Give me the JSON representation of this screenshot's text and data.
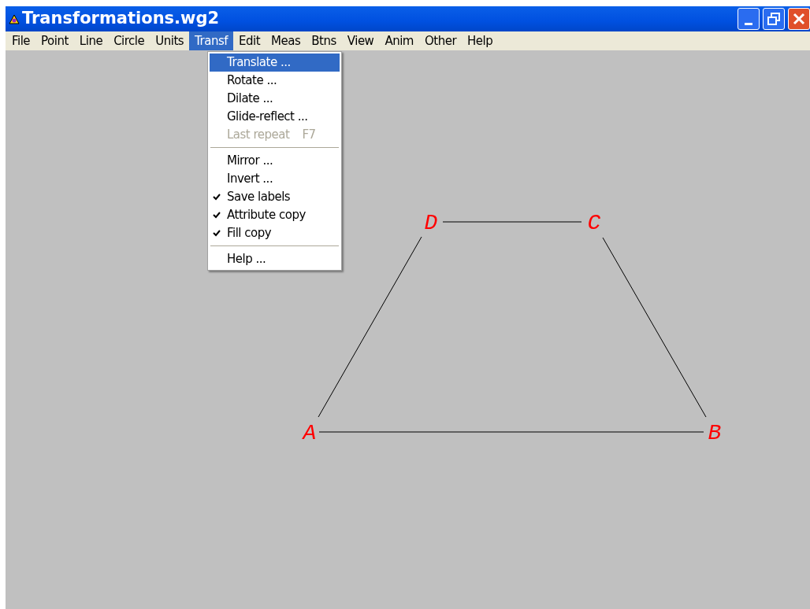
{
  "window": {
    "title": "Transformations.wg2"
  },
  "menu_bar": [
    {
      "label": "File",
      "selected": false
    },
    {
      "label": "Point",
      "selected": false
    },
    {
      "label": "Line",
      "selected": false
    },
    {
      "label": "Circle",
      "selected": false
    },
    {
      "label": "Units",
      "selected": false
    },
    {
      "label": "Transf",
      "selected": true
    },
    {
      "label": "Edit",
      "selected": false
    },
    {
      "label": "Meas",
      "selected": false
    },
    {
      "label": "Btns",
      "selected": false
    },
    {
      "label": "View",
      "selected": false
    },
    {
      "label": "Anim",
      "selected": false
    },
    {
      "label": "Other",
      "selected": false
    },
    {
      "label": "Help",
      "selected": false
    }
  ],
  "dropdown": [
    {
      "kind": "item",
      "label": "Translate ...",
      "selected": true,
      "disabled": false,
      "checked": false
    },
    {
      "kind": "item",
      "label": "Rotate ...",
      "selected": false,
      "disabled": false,
      "checked": false
    },
    {
      "kind": "item",
      "label": "Dilate ...",
      "selected": false,
      "disabled": false,
      "checked": false
    },
    {
      "kind": "item",
      "label": "Glide-reflect ...",
      "selected": false,
      "disabled": false,
      "checked": false
    },
    {
      "kind": "item",
      "label": "Last repeat",
      "shortcut": "F7",
      "selected": false,
      "disabled": true,
      "checked": false
    },
    {
      "kind": "separator"
    },
    {
      "kind": "item",
      "label": "Mirror ...",
      "selected": false,
      "disabled": false,
      "checked": false
    },
    {
      "kind": "item",
      "label": "Invert ...",
      "selected": false,
      "disabled": false,
      "checked": false
    },
    {
      "kind": "item",
      "label": "Save labels",
      "selected": false,
      "disabled": false,
      "checked": true
    },
    {
      "kind": "item",
      "label": "Attribute copy",
      "selected": false,
      "disabled": false,
      "checked": true
    },
    {
      "kind": "item",
      "label": "Fill copy",
      "selected": false,
      "disabled": false,
      "checked": true
    },
    {
      "kind": "separator"
    },
    {
      "kind": "item",
      "label": "Help ...",
      "selected": false,
      "disabled": false,
      "checked": false
    }
  ],
  "canvas": {
    "points": [
      "A",
      "B",
      "C",
      "D"
    ]
  }
}
